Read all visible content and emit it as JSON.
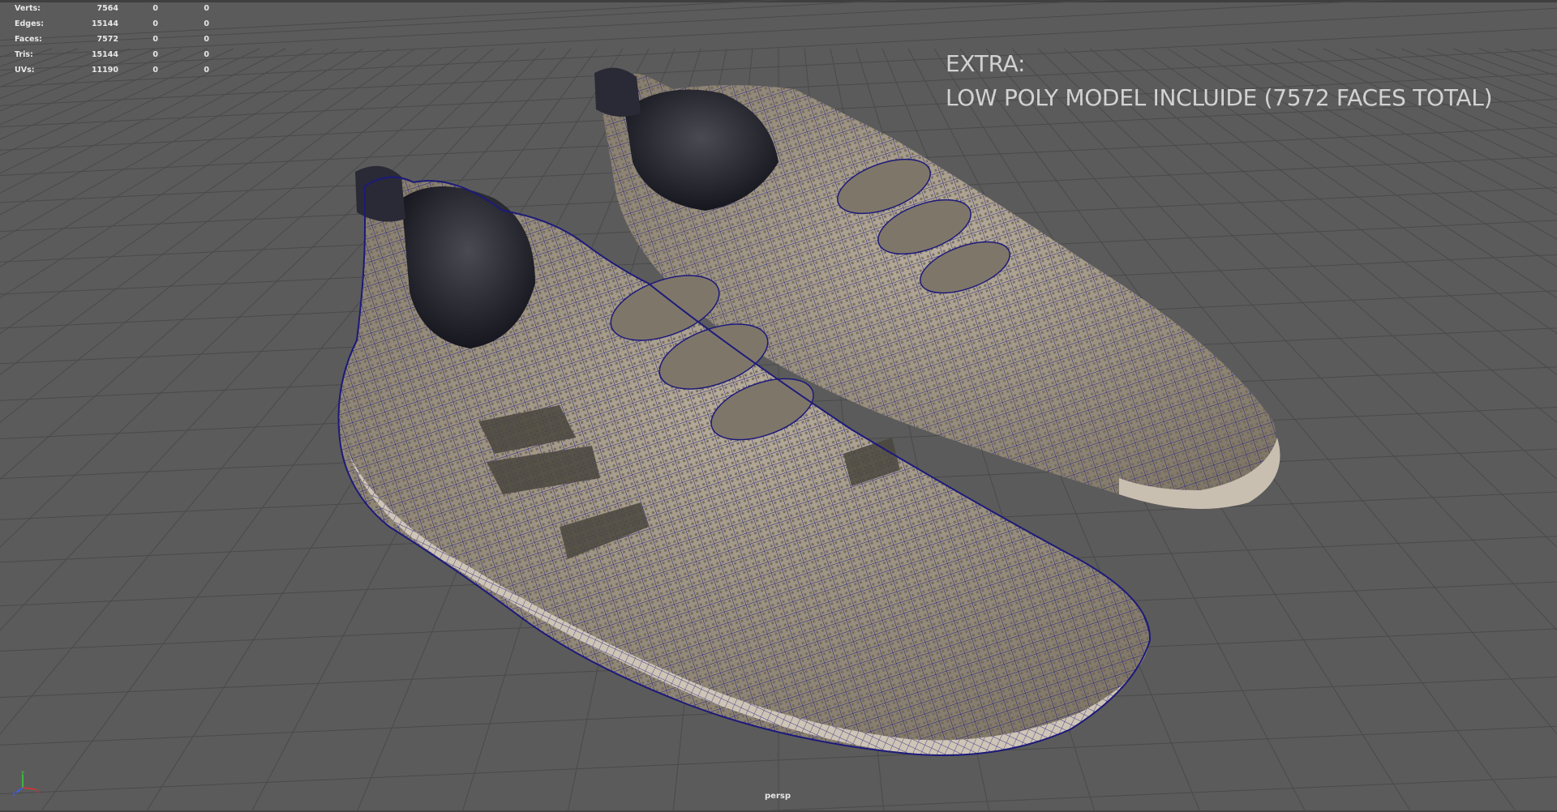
{
  "hud": {
    "rows": [
      {
        "label": "Verts:",
        "v1": "7564",
        "v2": "0",
        "v3": "0"
      },
      {
        "label": "Edges:",
        "v1": "15144",
        "v2": "0",
        "v3": "0"
      },
      {
        "label": "Faces:",
        "v1": "7572",
        "v2": "0",
        "v3": "0"
      },
      {
        "label": "Tris:",
        "v1": "15144",
        "v2": "0",
        "v3": "0"
      },
      {
        "label": "UVs:",
        "v1": "11190",
        "v2": "0",
        "v3": "0"
      }
    ]
  },
  "annotation": {
    "line1": "EXTRA:",
    "line2": "LOW POLY MODEL INCLUIDE (7572 FACES TOTAL)"
  },
  "viewport": {
    "camera": "persp",
    "background_color": "#5b5b5b",
    "grid_color": "#4a4a4a",
    "wireframe_color": "#1c1a7a",
    "model_color": "#a89c8c"
  },
  "axis_gizmo": {
    "x": "x",
    "y": "y",
    "z": "z"
  },
  "icons": {
    "axis": "axis-gizmo-icon"
  }
}
